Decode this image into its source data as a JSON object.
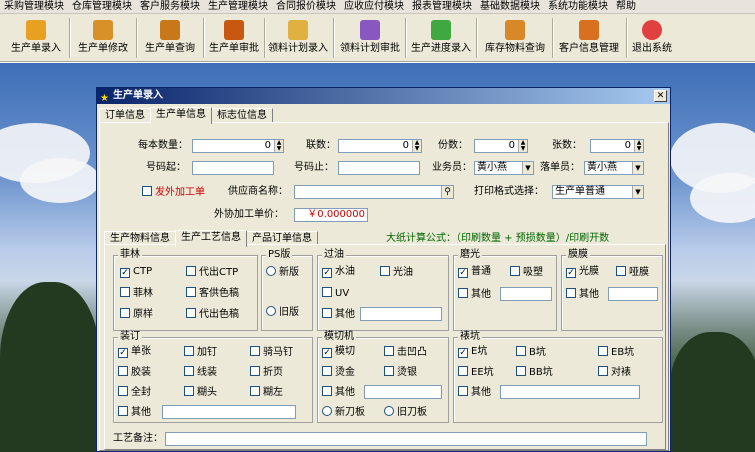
{
  "menu": [
    "采购管理模块",
    "仓库管理模块",
    "客户服务模块",
    "生产管理模块",
    "合同报价模块",
    "应收应付模块",
    "报表管理模块",
    "基础数据模块",
    "系统功能模块",
    "帮助"
  ],
  "toolbar": [
    {
      "label": "生产单录入",
      "icon": "box-icon",
      "color": "#e8a020"
    },
    {
      "label": "生产单修改",
      "icon": "box-edit-icon",
      "color": "#d89028"
    },
    {
      "label": "生产单查询",
      "icon": "box-search-icon",
      "color": "#c87818"
    },
    {
      "label": "生产单审批",
      "icon": "box-approve-icon",
      "color": "#c85810"
    },
    {
      "label": "领料计划录入",
      "icon": "material-plan-icon",
      "color": "#e0b040"
    },
    {
      "label": "领料计划审批",
      "icon": "material-approve-icon",
      "color": "#8858c0"
    },
    {
      "label": "生产进度录入",
      "icon": "progress-icon",
      "color": "#40a840"
    },
    {
      "label": "库存物料查询",
      "icon": "inventory-icon",
      "color": "#d88828"
    },
    {
      "label": "客户信息管理",
      "icon": "customer-icon",
      "color": "#d87020"
    },
    {
      "label": "退出系统",
      "icon": "exit-icon",
      "color": "#e04040"
    }
  ],
  "window": {
    "title": "生产单录入",
    "close": "✕"
  },
  "top_tabs": [
    "订单信息",
    "生产单信息",
    "标志位信息"
  ],
  "form": {
    "per_qty_label": "每本数量：",
    "per_qty": "0",
    "copies_label": "联数：",
    "copies": "0",
    "sets_label": "份数：",
    "sets": "0",
    "sheets_label": "张数：",
    "sheets": "0",
    "num_start_label": "号码起：",
    "num_start": "",
    "num_end_label": "号码止：",
    "num_end": "",
    "salesman_label": "业务员：",
    "salesman": "黄小燕",
    "order_taker_label": "落单员：",
    "order_taker": "黄小燕",
    "outsource_label": "发外加工单",
    "supplier_label": "供应商名称：",
    "supplier": "",
    "print_format_label": "打印格式选择：",
    "print_format": "生产单普通",
    "outsource_price_label": "外协加工单价：",
    "outsource_price": "￥0.000000"
  },
  "sub_tabs": [
    "生产物料信息",
    "生产工艺信息",
    "产品订单信息"
  ],
  "formula": "大纸计算公式：（印刷数量 + 预损数量）/印刷开数",
  "groups": {
    "film": {
      "title": "菲林",
      "items": [
        {
          "label": "CTP",
          "checked": true
        },
        {
          "label": "代出CTP",
          "checked": false
        },
        {
          "label": "菲林",
          "checked": false
        },
        {
          "label": "客供色稿",
          "checked": false
        },
        {
          "label": "原样",
          "checked": false
        },
        {
          "label": "代出色稿",
          "checked": false
        }
      ]
    },
    "ps": {
      "title": "PS版",
      "items": [
        {
          "label": "新版",
          "checked": false
        },
        {
          "label": "旧版",
          "checked": false
        }
      ]
    },
    "oil": {
      "title": "过油",
      "items": [
        {
          "label": "水油",
          "checked": true
        },
        {
          "label": "光油",
          "checked": false
        },
        {
          "label": "UV",
          "checked": false
        },
        {
          "label": "其他",
          "checked": false
        }
      ]
    },
    "polish": {
      "title": "磨光",
      "items": [
        {
          "label": "普通",
          "checked": true
        },
        {
          "label": "吸塑",
          "checked": false
        },
        {
          "label": "其他",
          "checked": false
        }
      ]
    },
    "laminate": {
      "title": "膜膜",
      "items": [
        {
          "label": "光膜",
          "checked": true
        },
        {
          "label": "哑膜",
          "checked": false
        },
        {
          "label": "其他",
          "checked": false
        }
      ]
    },
    "binding": {
      "title": "装订",
      "items": [
        {
          "label": "单张",
          "checked": true
        },
        {
          "label": "加钉",
          "checked": false
        },
        {
          "label": "骑马钉",
          "checked": false
        },
        {
          "label": "胶装",
          "checked": false
        },
        {
          "label": "线装",
          "checked": false
        },
        {
          "label": "折页",
          "checked": false
        },
        {
          "label": "全封",
          "checked": false
        },
        {
          "label": "糊头",
          "checked": false
        },
        {
          "label": "糊左",
          "checked": false
        },
        {
          "label": "其他",
          "checked": false
        }
      ]
    },
    "diecut": {
      "title": "模切机",
      "items": [
        {
          "label": "模切",
          "checked": true
        },
        {
          "label": "击凹凸",
          "checked": false
        },
        {
          "label": "烫金",
          "checked": false
        },
        {
          "label": "烫银",
          "checked": false
        },
        {
          "label": "其他",
          "checked": false
        },
        {
          "label": "新刀板",
          "checked": false
        },
        {
          "label": "旧刀板",
          "checked": false
        }
      ]
    },
    "flute": {
      "title": "裱坑",
      "items": [
        {
          "label": "E坑",
          "checked": true
        },
        {
          "label": "B坑",
          "checked": false
        },
        {
          "label": "EB坑",
          "checked": false
        },
        {
          "label": "EE坑",
          "checked": false
        },
        {
          "label": "BB坑",
          "checked": false
        },
        {
          "label": "对裱",
          "checked": false
        },
        {
          "label": "其他",
          "checked": false
        }
      ]
    }
  },
  "remark_label": "工艺备注："
}
